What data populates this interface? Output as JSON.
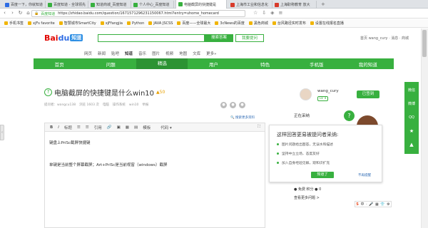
{
  "tabs": [
    {
      "label": "百度一下，你就知道",
      "color": "#2e6ce4"
    },
    {
      "label": "百度知道 - 全球领先",
      "color": "#38b03f"
    },
    {
      "label": "知道商城_百度知道",
      "color": "#38b03f"
    },
    {
      "label": "个人中心_百度知道",
      "color": "#38b03f"
    },
    {
      "label": "电脑截屏的快捷键是",
      "color": "#38b03f"
    },
    {
      "label": "上海市工业和信息化",
      "color": "#d83b2b"
    },
    {
      "label": "上海职称教育 放大",
      "color": "#d83b2b"
    }
  ],
  "address": {
    "secure": "百度知道",
    "url": "https://zhidao.baidu.com/question/1671571296231150067.html?entry=uhome_homecard"
  },
  "bookmarks": [
    "手机书签",
    "xjFs favorite",
    "智慧城市SmartCity",
    "xjFfangjia",
    "Python",
    "JAVA JSCSS",
    "百度——全球最大",
    "3cNews的百度",
    "黑色商城",
    "台风路径实时发布",
    "设置在线报名直播"
  ],
  "header": {
    "logo": "Bai",
    "logo_du": "du",
    "logo_zd": "知道",
    "ask_button": "搜索答案",
    "my_button": "我要提问",
    "top_links": "首页   wang_cury  ·  消息  ·  商城"
  },
  "subnav": [
    "网页",
    "新闻",
    "贴吧",
    "知道",
    "音乐",
    "图片",
    "视频",
    "地图",
    "文库",
    "更多»"
  ],
  "greennav": [
    "首页",
    "问题",
    "精选",
    "用户",
    "特色",
    "手机版",
    "我的知道"
  ],
  "question": {
    "title": "电脑截屏的快捷键是什么win10",
    "reward": "50",
    "meta": [
      "提问者：wangcu138",
      "浏览 1603 次",
      "电脑",
      "操作系统",
      "win10",
      "举报"
    ],
    "more_link": "搜索更多资料"
  },
  "editor": {
    "toolbar": [
      "B",
      "I",
      "标题",
      "☰",
      "☰",
      "引用",
      "🔗",
      "▣",
      "▦",
      "▤",
      "模板",
      "代码 ▾"
    ],
    "line1": "键盘上PriSc截屏快捷键",
    "line2": "单键是当前整个屏幕截屏；Art+PriSc是当前视窗（windows）截屏"
  },
  "sidebar": {
    "username": "wang_cury",
    "level": "LV 4",
    "signin": "已签到",
    "solving": "正在采纳",
    "tag_row": "● 免费 积分 ● 0",
    "more_list": "查看更多问题 >"
  },
  "popup": {
    "title": "这样回答更易被提问者采纳:",
    "items": [
      "图片问题给出图答，无误水和描述",
      "坚持中立立场，态度友好",
      "加入自身经验见解，观和识扩充"
    ],
    "know_button": "知道了",
    "no_remind": "不再提醒"
  },
  "rightbar": [
    "微信",
    "微博",
    "QQ",
    "★",
    "▲"
  ],
  "sogou": [
    "S",
    "中",
    "·",
    "🎤",
    "▦",
    "👕",
    "⚙"
  ]
}
